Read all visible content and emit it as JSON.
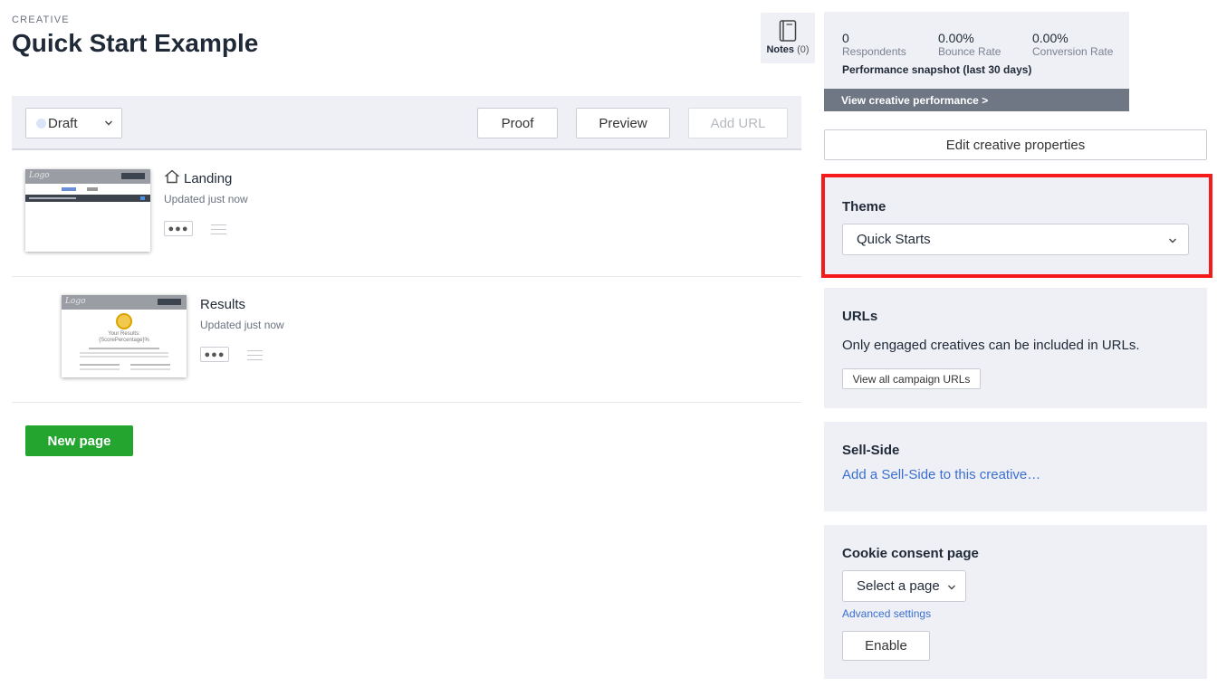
{
  "header": {
    "eyebrow": "CREATIVE",
    "title": "Quick Start Example",
    "notes_label": "Notes",
    "notes_count": "(0)"
  },
  "toolbar": {
    "status": "Draft",
    "proof": "Proof",
    "preview": "Preview",
    "add_url": "Add URL"
  },
  "pages": [
    {
      "name": "Landing",
      "updated": "Updated just now",
      "is_home": true
    },
    {
      "name": "Results",
      "updated": "Updated just now",
      "is_home": false
    }
  ],
  "thumb_text": {
    "logo": "Logo",
    "results_heading": "Your Results:",
    "results_sub": "{ScorePercentage}%"
  },
  "new_page": "New page",
  "performance": {
    "stats": [
      {
        "value": "0",
        "label": "Respondents"
      },
      {
        "value": "0.00%",
        "label": "Bounce Rate"
      },
      {
        "value": "0.00%",
        "label": "Conversion Rate"
      }
    ],
    "caption": "Performance snapshot (last 30 days)",
    "link": "View creative performance >"
  },
  "edit_props": "Edit creative properties",
  "theme": {
    "heading": "Theme",
    "selected": "Quick Starts",
    "highlight_color": "#f51b1b"
  },
  "urls": {
    "heading": "URLs",
    "text": "Only engaged creatives can be included in URLs.",
    "button": "View all campaign URLs"
  },
  "sellside": {
    "heading": "Sell-Side",
    "link": "Add a Sell-Side to this creative…"
  },
  "cookie": {
    "heading": "Cookie consent page",
    "select": "Select a page",
    "advanced": "Advanced settings",
    "enable": "Enable"
  }
}
